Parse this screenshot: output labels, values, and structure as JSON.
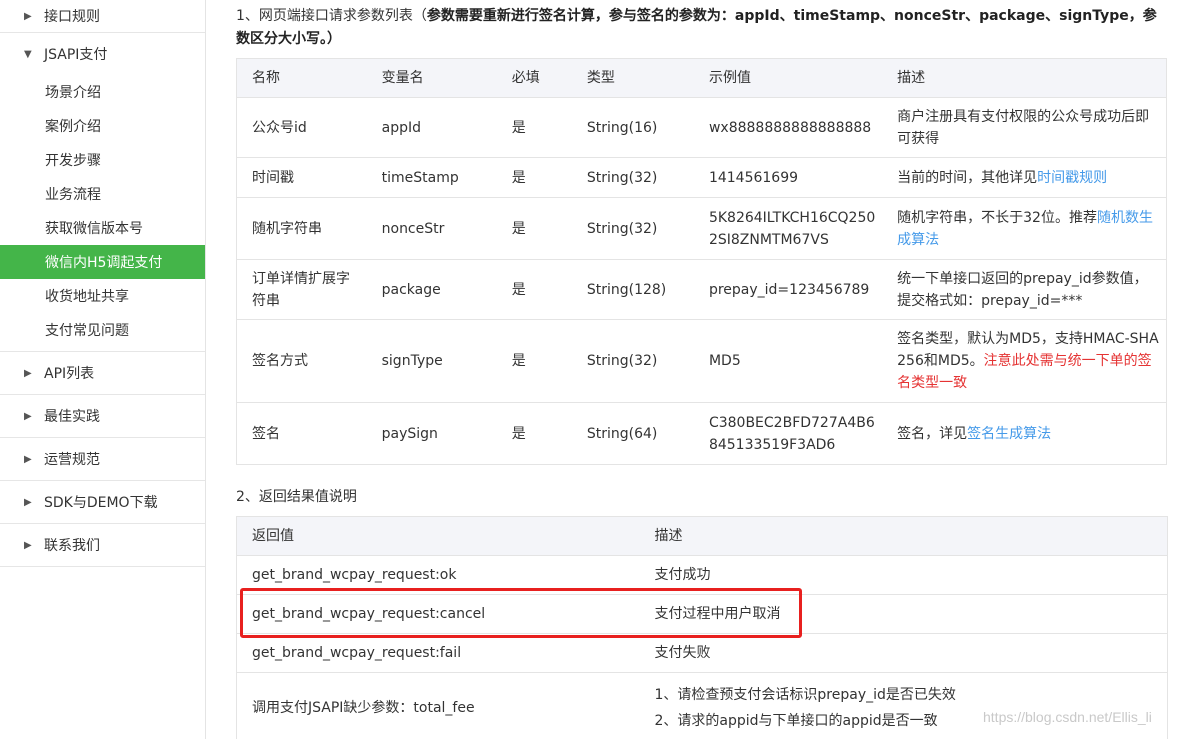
{
  "sidebar": {
    "groups": [
      {
        "label": "接口规则",
        "expanded": false
      },
      {
        "label": "JSAPI支付",
        "expanded": true,
        "items": [
          {
            "label": "场景介绍"
          },
          {
            "label": "案例介绍"
          },
          {
            "label": "开发步骤"
          },
          {
            "label": "业务流程"
          },
          {
            "label": "获取微信版本号"
          },
          {
            "label": "微信内H5调起支付",
            "active": true
          },
          {
            "label": "收货地址共享"
          },
          {
            "label": "支付常见问题"
          }
        ]
      },
      {
        "label": "API列表",
        "expanded": false
      },
      {
        "label": "最佳实践",
        "expanded": false
      },
      {
        "label": "运营规范",
        "expanded": false
      },
      {
        "label": "SDK与DEMO下载",
        "expanded": false
      },
      {
        "label": "联系我们",
        "expanded": false
      }
    ]
  },
  "section1": {
    "prefix": "1、网页端接口请求参数列表（",
    "bold": "参数需要重新进行签名计算，参与签名的参数为：appId、timeStamp、nonceStr、package、signType，参数区分大小写。）",
    "headers": [
      "名称",
      "变量名",
      "必填",
      "类型",
      "示例值",
      "描述"
    ],
    "rows": [
      {
        "name": "公众号id",
        "var": "appId",
        "required": "是",
        "type": "String(16)",
        "example": "wx8888888888888888",
        "desc": "商户注册具有支付权限的公众号成功后即可获得"
      },
      {
        "name": "时间戳",
        "var": "timeStamp",
        "required": "是",
        "type": "String(32)",
        "example": "1414561699",
        "desc_text": "当前的时间，其他详见",
        "desc_link": "时间戳规则"
      },
      {
        "name": "随机字符串",
        "var": "nonceStr",
        "required": "是",
        "type": "String(32)",
        "example": "5K8264ILTKCH16CQ2502SI8ZNMTM67VS",
        "desc_text": "随机字符串，不长于32位。推荐",
        "desc_link": "随机数生成算法"
      },
      {
        "name": "订单详情扩展字符串",
        "var": "package",
        "required": "是",
        "type": "String(128)",
        "example": "prepay_id=123456789",
        "desc": "统一下单接口返回的prepay_id参数值，提交格式如：prepay_id=***"
      },
      {
        "name": "签名方式",
        "var": "signType",
        "required": "是",
        "type": "String(32)",
        "example": "MD5",
        "desc_text": "签名类型，默认为MD5，支持HMAC-SHA256和MD5。",
        "desc_red": "注意此处需与统一下单的签名类型一致"
      },
      {
        "name": "签名",
        "var": "paySign",
        "required": "是",
        "type": "String(64)",
        "example": "C380BEC2BFD727A4B6845133519F3AD6",
        "desc_text": "签名，详见",
        "desc_link": "签名生成算法"
      }
    ]
  },
  "section2": {
    "title": "2、返回结果值说明",
    "headers": [
      "返回值",
      "描述"
    ],
    "rows": [
      {
        "value": "get_brand_wcpay_request:ok",
        "desc": "支付成功"
      },
      {
        "value": "get_brand_wcpay_request:cancel",
        "desc": "支付过程中用户取消"
      },
      {
        "value": "get_brand_wcpay_request:fail",
        "desc": "支付失败"
      },
      {
        "value": "调用支付JSAPI缺少参数：total_fee",
        "desc_lines": [
          "1、请检查预支付会话标识prepay_id是否已失效",
          "2、请求的appid与下单接口的appid是否一致"
        ]
      }
    ]
  },
  "watermark": "https://blog.csdn.net/Ellis_li",
  "colors": {
    "active_green": "#44b549",
    "link_blue": "#459ae9",
    "warning_red": "#e53333",
    "highlight_red": "#e8201f"
  }
}
